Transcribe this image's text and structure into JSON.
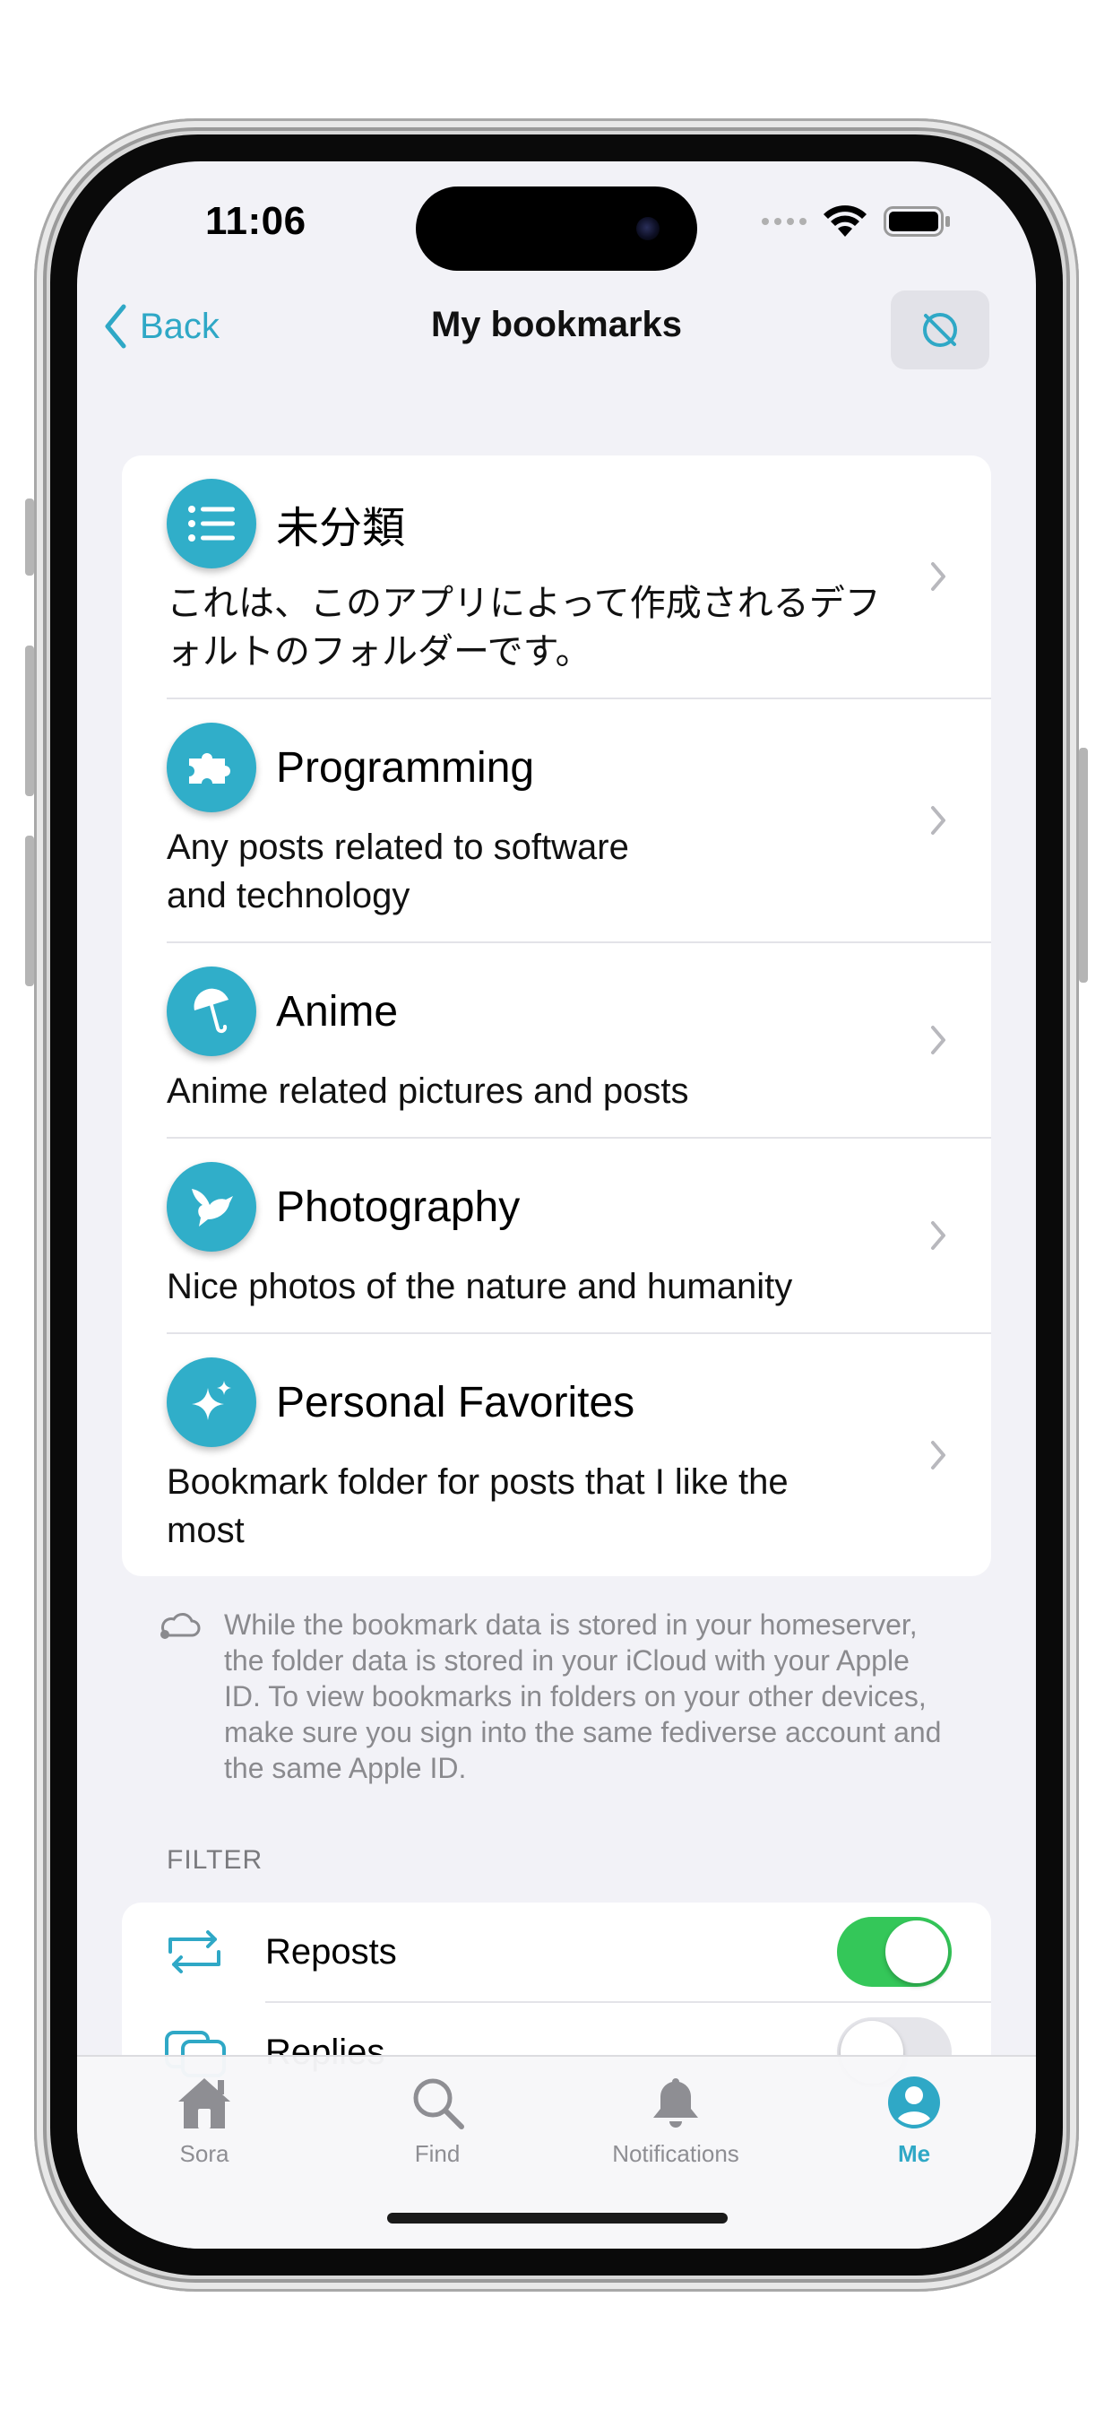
{
  "status_bar": {
    "time": "11:06"
  },
  "nav": {
    "back_label": "Back",
    "title": "My bookmarks",
    "action_icon": "eye-slash-icon"
  },
  "folders": [
    {
      "icon": "list-icon",
      "title": "未分類",
      "description": "これは、このアプリによって作成されるデフォルトのフォルダーです。"
    },
    {
      "icon": "puzzle-icon",
      "title": "Programming",
      "description": "Any posts related to software and technology"
    },
    {
      "icon": "umbrella-icon",
      "title": "Anime",
      "description": "Anime related pictures and posts"
    },
    {
      "icon": "bird-icon",
      "title": "Photography",
      "description": "Nice photos of the nature and humanity"
    },
    {
      "icon": "sparkles-icon",
      "title": "Personal Favorites",
      "description": "Bookmark folder for posts that I like the most"
    }
  ],
  "footnote": {
    "icon": "cloud-icon",
    "text": "While the bookmark data is stored in your homeserver, the folder data is stored in your iCloud with your Apple ID. To view bookmarks in folders on your other devices, make sure you sign into the same fediverse account and the same Apple ID."
  },
  "filter": {
    "section_label": "FILTER",
    "items": [
      {
        "label": "Reposts",
        "icon": "repost-icon",
        "on": true
      },
      {
        "label": "Replies",
        "icon": "replies-icon",
        "on": false
      }
    ]
  },
  "tabs": [
    {
      "label": "Sora",
      "icon": "house-icon",
      "active": false
    },
    {
      "label": "Find",
      "icon": "magnifier-icon",
      "active": false
    },
    {
      "label": "Notifications",
      "icon": "bell-icon",
      "active": false
    },
    {
      "label": "Me",
      "icon": "person-circle-icon",
      "active": true
    }
  ],
  "colors": {
    "accent": "#2fa8c6",
    "folder_icon_bg": "#30aec9",
    "toggle_on": "#34c759",
    "toggle_off": "#e5e5ea",
    "tab_inactive": "#8e8e93",
    "background": "#f2f2f7"
  }
}
